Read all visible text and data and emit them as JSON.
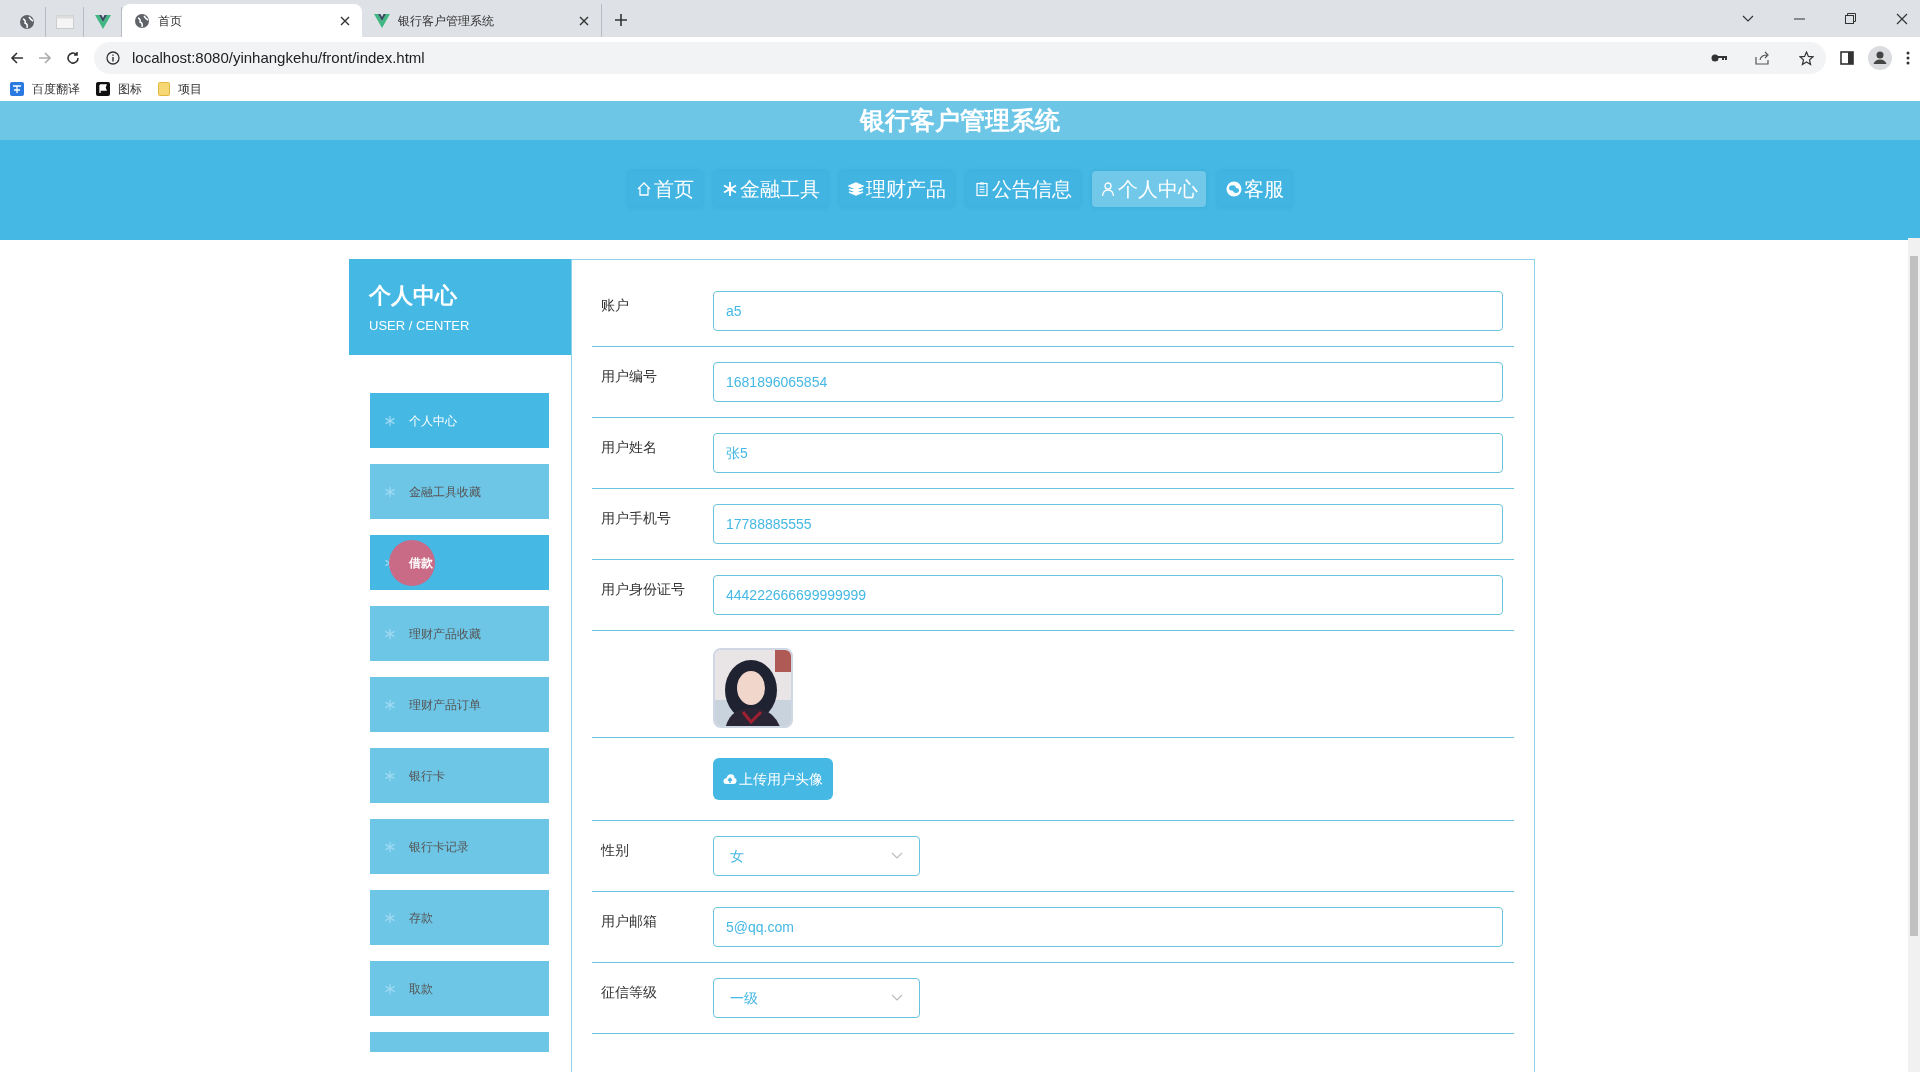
{
  "browser": {
    "tabs": [
      {
        "kind": "globe",
        "selected": false
      },
      {
        "kind": "blank",
        "selected": false
      },
      {
        "kind": "vue",
        "selected": false
      },
      {
        "kind": "globe",
        "title": "首页",
        "selected": true
      },
      {
        "kind": "vue",
        "title": "银行客户管理系统",
        "selected": false
      }
    ],
    "url": "localhost:8080/yinhangkehu/front/index.html",
    "bookmarks": [
      {
        "kind": "translate",
        "label": "百度翻译"
      },
      {
        "kind": "flag",
        "label": "图标"
      },
      {
        "kind": "folder",
        "label": "项目"
      }
    ]
  },
  "site_title": "银行客户管理系统",
  "nav": [
    {
      "kind": "home",
      "label": "首页",
      "selected": false
    },
    {
      "kind": "snowflake",
      "label": "金融工具",
      "selected": false
    },
    {
      "kind": "layers",
      "label": "理财产品",
      "selected": false
    },
    {
      "kind": "clipboard",
      "label": "公告信息",
      "selected": false
    },
    {
      "kind": "user",
      "label": "个人中心",
      "selected": true
    },
    {
      "kind": "chat",
      "label": "客服",
      "selected": false
    }
  ],
  "sidebar": {
    "title": "个人中心",
    "subtitle": "USER / CENTER",
    "items": [
      {
        "label": "个人中心",
        "selected": true
      },
      {
        "label": "金融工具收藏",
        "selected": false
      },
      {
        "label": "借款",
        "selected": true,
        "clicked": true
      },
      {
        "label": "理财产品收藏",
        "selected": false
      },
      {
        "label": "理财产品订单",
        "selected": false
      },
      {
        "label": "银行卡",
        "selected": false
      },
      {
        "label": "银行卡记录",
        "selected": false
      },
      {
        "label": "存款",
        "selected": false
      },
      {
        "label": "取款",
        "selected": false
      }
    ]
  },
  "form": [
    {
      "kind": "text",
      "label": "账户",
      "value": "a5"
    },
    {
      "kind": "text",
      "label": "用户编号",
      "value": "1681896065854"
    },
    {
      "kind": "text",
      "label": "用户姓名",
      "value": "张5"
    },
    {
      "kind": "text",
      "label": "用户手机号",
      "value": "17788885555"
    },
    {
      "kind": "text",
      "label": "用户身份证号",
      "value": "444222666699999999"
    },
    {
      "kind": "avatar"
    },
    {
      "kind": "upload",
      "value": "上传用户头像"
    },
    {
      "kind": "select",
      "label": "性别",
      "value": "女"
    },
    {
      "kind": "text",
      "label": "用户邮箱",
      "value": "5@qq.com"
    },
    {
      "kind": "select",
      "label": "征信等级",
      "value": "一级"
    }
  ]
}
